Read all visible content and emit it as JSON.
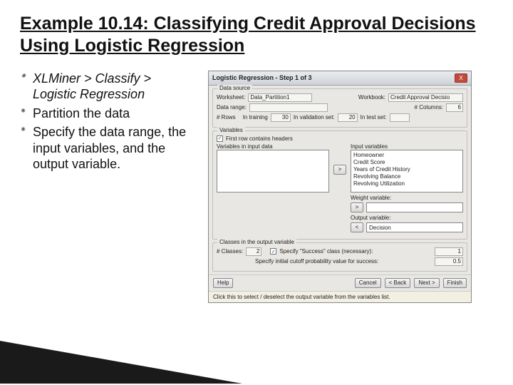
{
  "slide": {
    "title": "Example 10.14: Classifying Credit Approval Decisions Using Logistic Regression",
    "bullets": [
      {
        "text": "XLMiner > Classify > Logistic Regression",
        "italic": true
      },
      {
        "text": "Partition the data",
        "italic": false
      },
      {
        "text": "Specify the data range, the input variables, and the output variable.",
        "italic": false
      }
    ]
  },
  "dialog": {
    "title": "Logistic Regression - Step 1 of 3",
    "close": "X",
    "data_source": {
      "legend": "Data source",
      "worksheet_label": "Worksheet:",
      "worksheet": "Data_Partition1",
      "workbook_label": "Workbook:",
      "workbook": "Credit Approval Decisio",
      "data_range_label": "Data range:",
      "data_range": "",
      "columns_label": "# Columns:",
      "columns": "6",
      "rows_label": "# Rows",
      "training_label": "In training",
      "training": "30",
      "validation_label": "In validation set:",
      "validation": "20",
      "test_label": "In test set:",
      "test": ""
    },
    "variables": {
      "legend": "Variables",
      "first_row_label": "First row contains headers",
      "input_caption": "Variables in input data",
      "input_list": [],
      "included_caption": "Input variables",
      "included_list": [
        "Homeowner",
        "Credit Score",
        "Years of Credit History",
        "Revolving Balance",
        "Revolving Utilization"
      ],
      "weight_label": "Weight variable:",
      "weight": "",
      "output_label": "Output variable:",
      "output": "Decision",
      "move_right": ">",
      "move_left": "<"
    },
    "classes": {
      "legend": "Classes in the output variable",
      "classes_label": "# Classes:",
      "classes": "2",
      "specify_label": "Specify \"Success\" class (necessary):",
      "success": "1",
      "cutoff_label": "Specify initial cutoff probability value for success:",
      "cutoff": "0.5"
    },
    "buttons": {
      "help": "Help",
      "cancel": "Cancel",
      "back": "< Back",
      "next": "Next >",
      "finish": "Finish"
    },
    "hint": "Click this to select / deselect the output variable from the variables list."
  }
}
